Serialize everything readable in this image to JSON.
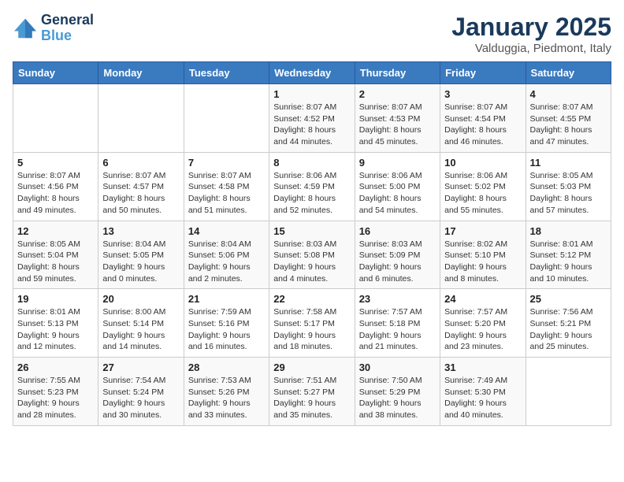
{
  "logo": {
    "line1": "General",
    "line2": "Blue"
  },
  "title": "January 2025",
  "subtitle": "Valduggia, Piedmont, Italy",
  "days_of_week": [
    "Sunday",
    "Monday",
    "Tuesday",
    "Wednesday",
    "Thursday",
    "Friday",
    "Saturday"
  ],
  "weeks": [
    [
      {
        "day": "",
        "content": ""
      },
      {
        "day": "",
        "content": ""
      },
      {
        "day": "",
        "content": ""
      },
      {
        "day": "1",
        "content": "Sunrise: 8:07 AM\nSunset: 4:52 PM\nDaylight: 8 hours\nand 44 minutes."
      },
      {
        "day": "2",
        "content": "Sunrise: 8:07 AM\nSunset: 4:53 PM\nDaylight: 8 hours\nand 45 minutes."
      },
      {
        "day": "3",
        "content": "Sunrise: 8:07 AM\nSunset: 4:54 PM\nDaylight: 8 hours\nand 46 minutes."
      },
      {
        "day": "4",
        "content": "Sunrise: 8:07 AM\nSunset: 4:55 PM\nDaylight: 8 hours\nand 47 minutes."
      }
    ],
    [
      {
        "day": "5",
        "content": "Sunrise: 8:07 AM\nSunset: 4:56 PM\nDaylight: 8 hours\nand 49 minutes."
      },
      {
        "day": "6",
        "content": "Sunrise: 8:07 AM\nSunset: 4:57 PM\nDaylight: 8 hours\nand 50 minutes."
      },
      {
        "day": "7",
        "content": "Sunrise: 8:07 AM\nSunset: 4:58 PM\nDaylight: 8 hours\nand 51 minutes."
      },
      {
        "day": "8",
        "content": "Sunrise: 8:06 AM\nSunset: 4:59 PM\nDaylight: 8 hours\nand 52 minutes."
      },
      {
        "day": "9",
        "content": "Sunrise: 8:06 AM\nSunset: 5:00 PM\nDaylight: 8 hours\nand 54 minutes."
      },
      {
        "day": "10",
        "content": "Sunrise: 8:06 AM\nSunset: 5:02 PM\nDaylight: 8 hours\nand 55 minutes."
      },
      {
        "day": "11",
        "content": "Sunrise: 8:05 AM\nSunset: 5:03 PM\nDaylight: 8 hours\nand 57 minutes."
      }
    ],
    [
      {
        "day": "12",
        "content": "Sunrise: 8:05 AM\nSunset: 5:04 PM\nDaylight: 8 hours\nand 59 minutes."
      },
      {
        "day": "13",
        "content": "Sunrise: 8:04 AM\nSunset: 5:05 PM\nDaylight: 9 hours\nand 0 minutes."
      },
      {
        "day": "14",
        "content": "Sunrise: 8:04 AM\nSunset: 5:06 PM\nDaylight: 9 hours\nand 2 minutes."
      },
      {
        "day": "15",
        "content": "Sunrise: 8:03 AM\nSunset: 5:08 PM\nDaylight: 9 hours\nand 4 minutes."
      },
      {
        "day": "16",
        "content": "Sunrise: 8:03 AM\nSunset: 5:09 PM\nDaylight: 9 hours\nand 6 minutes."
      },
      {
        "day": "17",
        "content": "Sunrise: 8:02 AM\nSunset: 5:10 PM\nDaylight: 9 hours\nand 8 minutes."
      },
      {
        "day": "18",
        "content": "Sunrise: 8:01 AM\nSunset: 5:12 PM\nDaylight: 9 hours\nand 10 minutes."
      }
    ],
    [
      {
        "day": "19",
        "content": "Sunrise: 8:01 AM\nSunset: 5:13 PM\nDaylight: 9 hours\nand 12 minutes."
      },
      {
        "day": "20",
        "content": "Sunrise: 8:00 AM\nSunset: 5:14 PM\nDaylight: 9 hours\nand 14 minutes."
      },
      {
        "day": "21",
        "content": "Sunrise: 7:59 AM\nSunset: 5:16 PM\nDaylight: 9 hours\nand 16 minutes."
      },
      {
        "day": "22",
        "content": "Sunrise: 7:58 AM\nSunset: 5:17 PM\nDaylight: 9 hours\nand 18 minutes."
      },
      {
        "day": "23",
        "content": "Sunrise: 7:57 AM\nSunset: 5:18 PM\nDaylight: 9 hours\nand 21 minutes."
      },
      {
        "day": "24",
        "content": "Sunrise: 7:57 AM\nSunset: 5:20 PM\nDaylight: 9 hours\nand 23 minutes."
      },
      {
        "day": "25",
        "content": "Sunrise: 7:56 AM\nSunset: 5:21 PM\nDaylight: 9 hours\nand 25 minutes."
      }
    ],
    [
      {
        "day": "26",
        "content": "Sunrise: 7:55 AM\nSunset: 5:23 PM\nDaylight: 9 hours\nand 28 minutes."
      },
      {
        "day": "27",
        "content": "Sunrise: 7:54 AM\nSunset: 5:24 PM\nDaylight: 9 hours\nand 30 minutes."
      },
      {
        "day": "28",
        "content": "Sunrise: 7:53 AM\nSunset: 5:26 PM\nDaylight: 9 hours\nand 33 minutes."
      },
      {
        "day": "29",
        "content": "Sunrise: 7:51 AM\nSunset: 5:27 PM\nDaylight: 9 hours\nand 35 minutes."
      },
      {
        "day": "30",
        "content": "Sunrise: 7:50 AM\nSunset: 5:29 PM\nDaylight: 9 hours\nand 38 minutes."
      },
      {
        "day": "31",
        "content": "Sunrise: 7:49 AM\nSunset: 5:30 PM\nDaylight: 9 hours\nand 40 minutes."
      },
      {
        "day": "",
        "content": ""
      }
    ]
  ]
}
